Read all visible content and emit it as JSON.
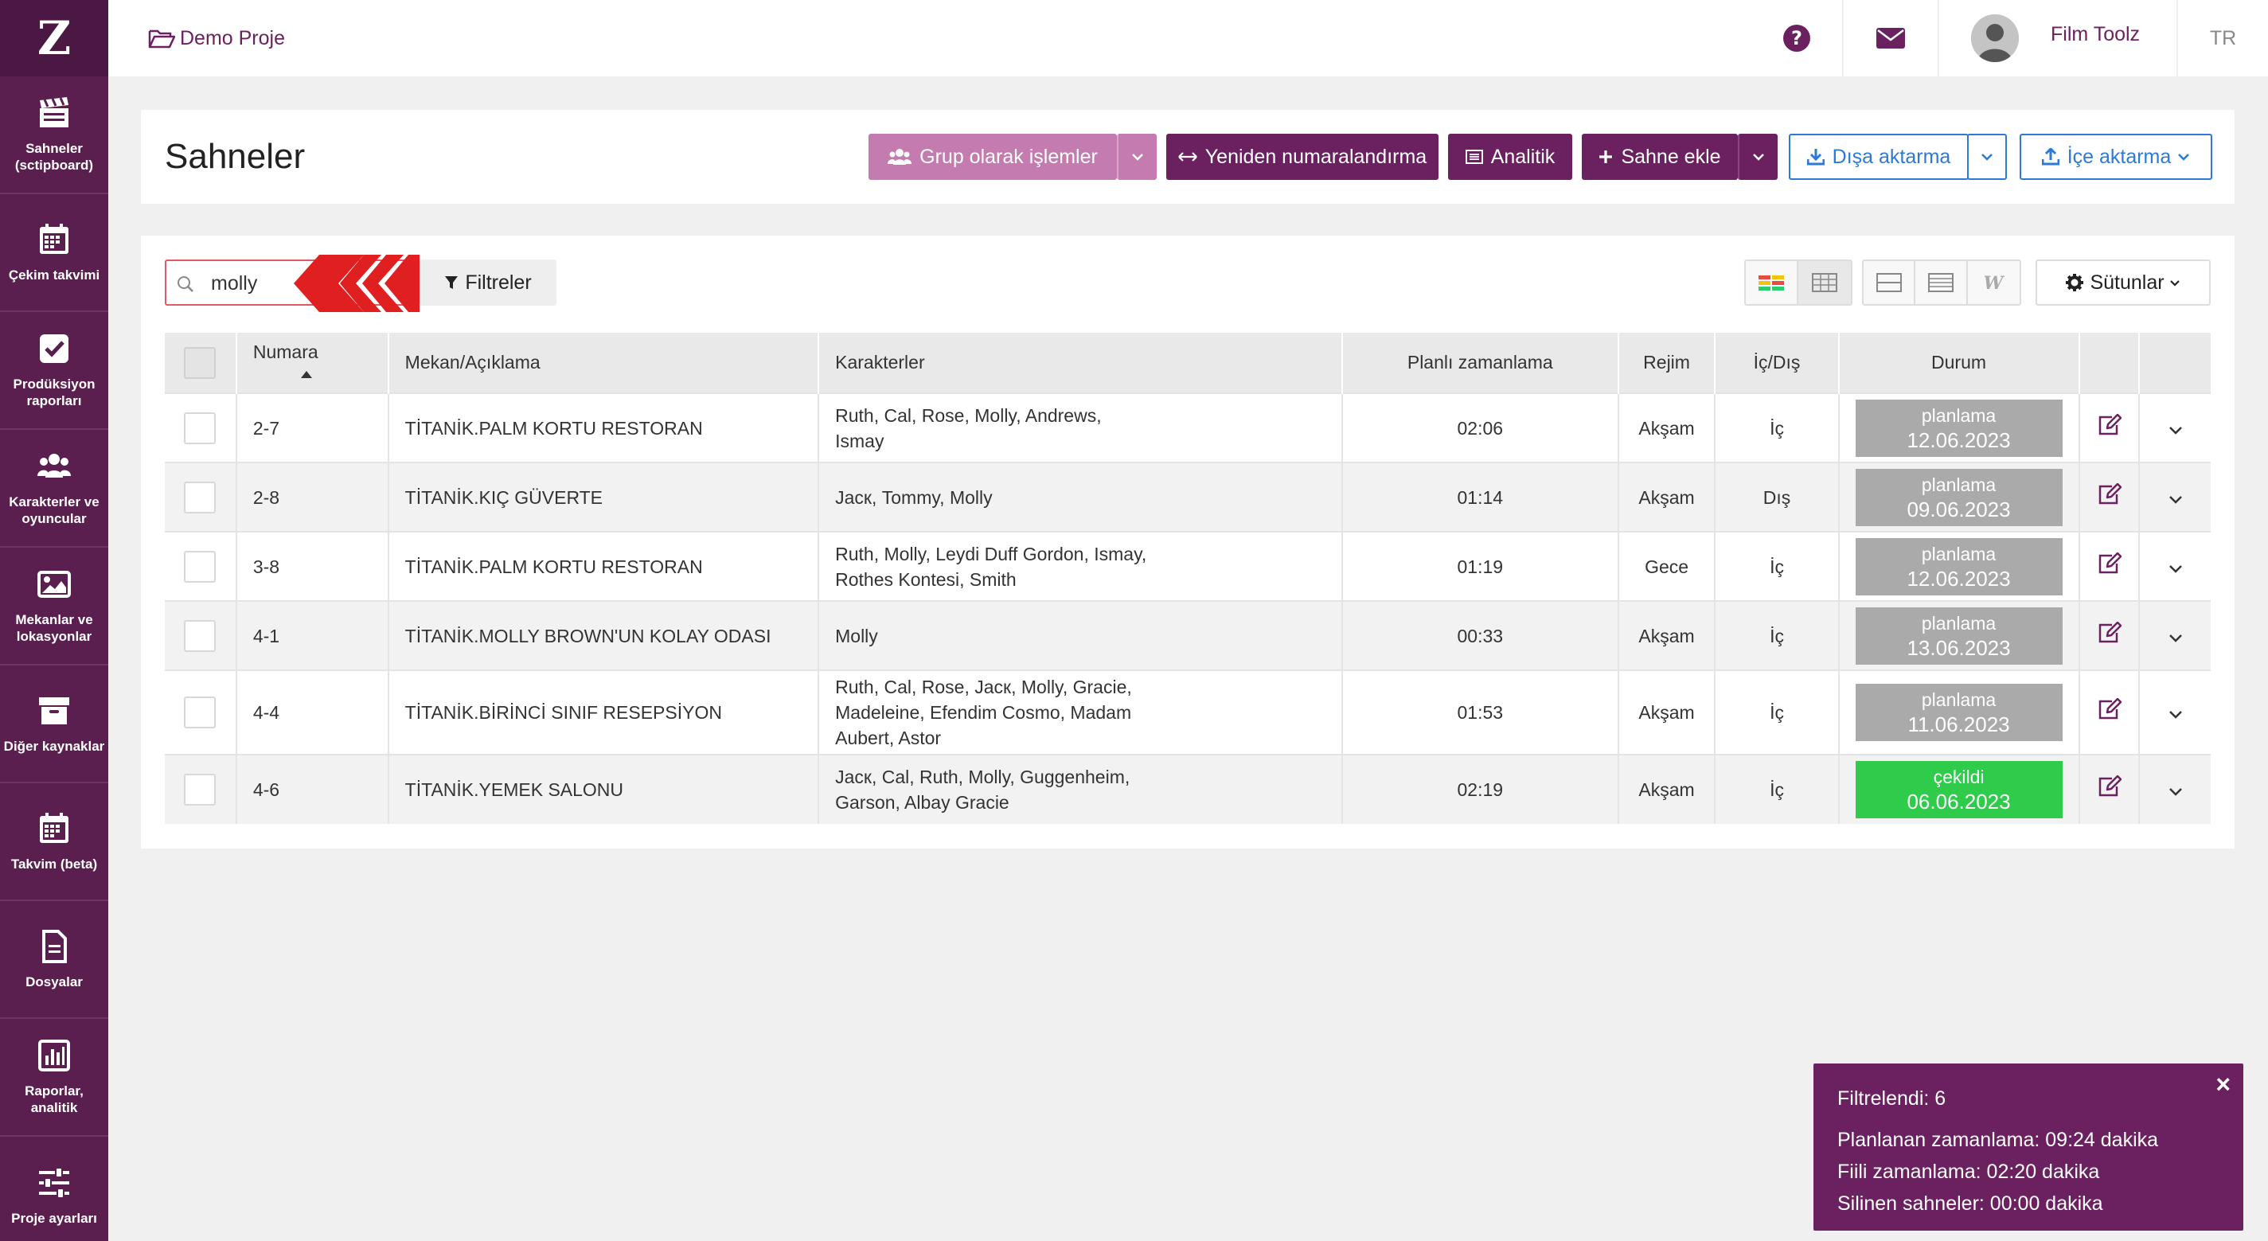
{
  "sidebar": {
    "logo": "Z",
    "items": [
      {
        "label": "Sahneler (sctipboard)",
        "icon": "clapperboard-icon"
      },
      {
        "label": "Çekim takvimi",
        "icon": "calendar-icon"
      },
      {
        "label": "Prodüksiyon raporları",
        "icon": "checkbox-icon"
      },
      {
        "label": "Karakterler ve oyuncular",
        "icon": "users-icon"
      },
      {
        "label": "Mekanlar ve lokasyonlar",
        "icon": "image-icon"
      },
      {
        "label": "Diğer kaynaklar",
        "icon": "archive-icon"
      },
      {
        "label": "Takvim (beta)",
        "icon": "calendar-icon"
      },
      {
        "label": "Dosyalar",
        "icon": "file-icon"
      },
      {
        "label": "Raporlar, analitik",
        "icon": "chart-icon"
      },
      {
        "label": "Proje ayarları",
        "icon": "sliders-icon"
      }
    ]
  },
  "topbar": {
    "project": "Demo Proje",
    "user": "Film Toolz",
    "lang": "TR"
  },
  "header": {
    "title": "Sahneler",
    "group_ops": "Grup olarak işlemler",
    "renumber": "Yeniden numaralandırma",
    "analytics": "Analitik",
    "add_scene": "Sahne ekle",
    "export": "Dışa aktarma",
    "import": "İçe aktarma"
  },
  "toolbar": {
    "search_value": "molly",
    "filters": "Filtreler",
    "columns": "Sütunlar"
  },
  "table": {
    "headers": [
      "Numara",
      "Mekan/Açıklama",
      "Karakterler",
      "Planlı zamanlama",
      "Rejim",
      "İç/Dış",
      "Durum"
    ],
    "rows": [
      {
        "num": "2-7",
        "place": "TİTANİK.PALM KORTU RESTORAN",
        "chars1": "Ruth, Cal, Rose, Molly, Andrews,",
        "chars2": "Ismay",
        "chars3": "",
        "time": "02:06",
        "regime": "Akşam",
        "io": "İç",
        "status": "planlama",
        "date": "12.06.2023",
        "done": false
      },
      {
        "num": "2-8",
        "place": "TİTANİK.KIÇ GÜVERTE",
        "chars1": "Jacк, Tommy, Molly",
        "chars2": "",
        "chars3": "",
        "time": "01:14",
        "regime": "Akşam",
        "io": "Dış",
        "status": "planlama",
        "date": "09.06.2023",
        "done": false
      },
      {
        "num": "3-8",
        "place": "TİTANİK.PALM KORTU RESTORAN",
        "chars1": "Ruth, Molly, Leydi Duff Gordon, Ismay,",
        "chars2": "Rothes Kontesi, Smith",
        "chars3": "",
        "time": "01:19",
        "regime": "Gece",
        "io": "İç",
        "status": "planlama",
        "date": "12.06.2023",
        "done": false
      },
      {
        "num": "4-1",
        "place": "TİTANİK.MOLLY BROWN'UN KOLAY ODASI",
        "chars1": "Molly",
        "chars2": "",
        "chars3": "",
        "time": "00:33",
        "regime": "Akşam",
        "io": "İç",
        "status": "planlama",
        "date": "13.06.2023",
        "done": false
      },
      {
        "num": "4-4",
        "place": "TİTANİK.BİRİNCİ SINIF RESEPSİYON",
        "chars1": "Ruth, Cal, Rose, Jacк, Molly, Gracie,",
        "chars2": "Madeleine, Efendim Cosmo, Madam",
        "chars3": "Aubert, Astor",
        "time": "01:53",
        "regime": "Akşam",
        "io": "İç",
        "status": "planlama",
        "date": "11.06.2023",
        "done": false
      },
      {
        "num": "4-6",
        "place": "TİTANİK.YEMEK SALONU",
        "chars1": "Jacк, Cal, Ruth, Molly, Guggenheim,",
        "chars2": "Garson, Albay Gracie",
        "chars3": "",
        "time": "02:19",
        "regime": "Akşam",
        "io": "İç",
        "status": "çekildi",
        "date": "06.06.2023",
        "done": true
      }
    ]
  },
  "toast": {
    "filtered": "Filtrelendi: 6",
    "planned": "Planlanan zamanlama: 09:24 dakika",
    "actual": "Fiili zamanlama: 02:20 dakika",
    "deleted": "Silinen sahneler: 00:00 dakika",
    "close": "×"
  },
  "colors": {
    "sidebar": "#5a1f4f",
    "accent": "#6b2160",
    "group_btn": "#c37bb0",
    "outline_btn": "#2d7ad6",
    "status_planned": "#aaaaaa",
    "status_done": "#2ecc4a",
    "search_border": "#e05a68"
  }
}
